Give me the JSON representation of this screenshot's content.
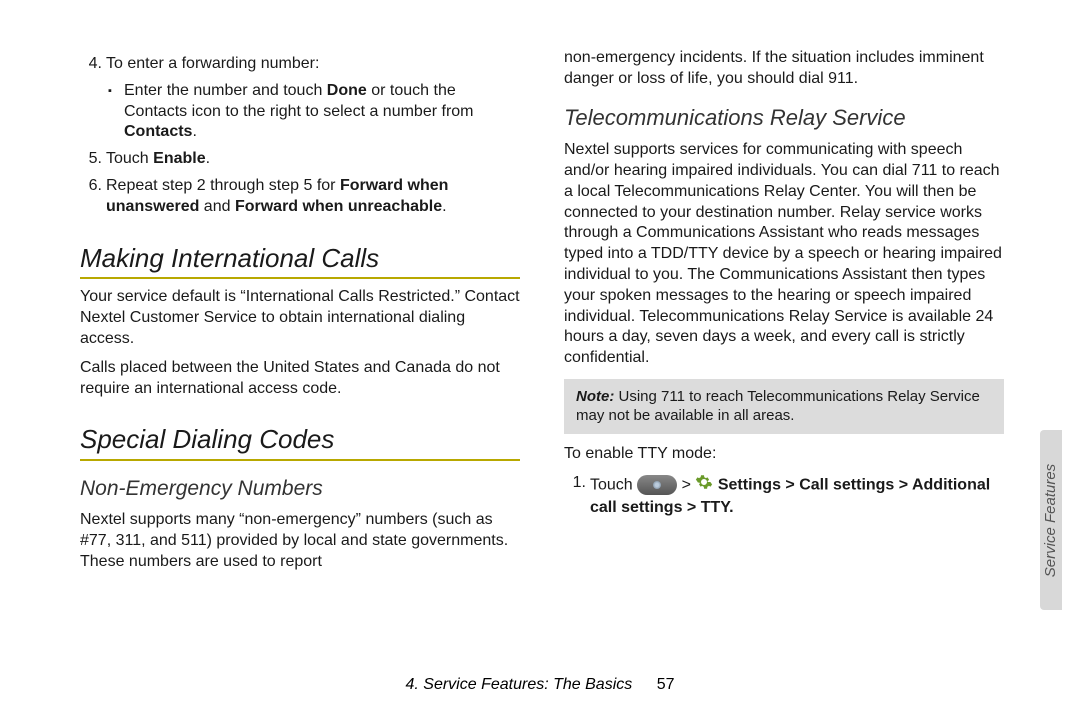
{
  "left": {
    "step4": "To enter a forwarding number:",
    "step4_bullet_pre": "Enter the number and touch ",
    "step4_bullet_done": "Done",
    "step4_bullet_mid": " or touch the Contacts icon to the right to select a number from ",
    "step4_bullet_contacts": "Contacts",
    "step4_bullet_end": ".",
    "step5_pre": "Touch ",
    "step5_enable": "Enable",
    "step5_end": ".",
    "step6_pre": "Repeat step 2 through step 5 for ",
    "step6_b1": "Forward when unanswered",
    "step6_mid": " and ",
    "step6_b2": "Forward when unreachable",
    "step6_end": ".",
    "h_intl": "Making International Calls",
    "intl_p1": "Your service default is “International Calls Restricted.” Contact Nextel Customer Service to obtain international dialing access.",
    "intl_p2": "Calls placed between the United States and Canada do not require an international access code.",
    "h_special": "Special Dialing Codes",
    "h_nonemerg": "Non-Emergency Numbers",
    "nonemerg_p": "Nextel supports many “non-emergency” numbers (such as #77, 311, and 511) provided by local and state governments. These numbers are used to report"
  },
  "right": {
    "cont": "non-emergency incidents. If the situation includes imminent danger or loss of life, you should dial 911.",
    "h_trs": "Telecommunications Relay Service",
    "trs_p": "Nextel supports services for communicating with speech and/or hearing impaired individuals. You can dial 711 to reach a local Telecommunications Relay Center. You will then be connected to your destination number. Relay service works through a Communications Assistant who reads messages typed into a TDD/TTY device by a speech or hearing impaired individual to you. The Communications Assistant then types your spoken messages to the hearing or speech impaired individual. Telecommunications Relay Service is available 24 hours a day, seven days a week, and every call is strictly confidential.",
    "note_label": "Note:",
    "note_text": " Using 711 to reach Telecommunications Relay Service may not be available in all areas.",
    "tty_intro": "To enable TTY mode:",
    "tty_step_pre": "Touch ",
    "tty_step_mid": "  >  ",
    "tty_step_b": " Settings > Call settings > Additional call settings > TTY.",
    "num4": "4.",
    "num5": "5.",
    "num6": "6.",
    "num1": "1."
  },
  "footer": {
    "chapter": "4. Service Features: The Basics",
    "page": "57"
  },
  "tab": "Service Features"
}
